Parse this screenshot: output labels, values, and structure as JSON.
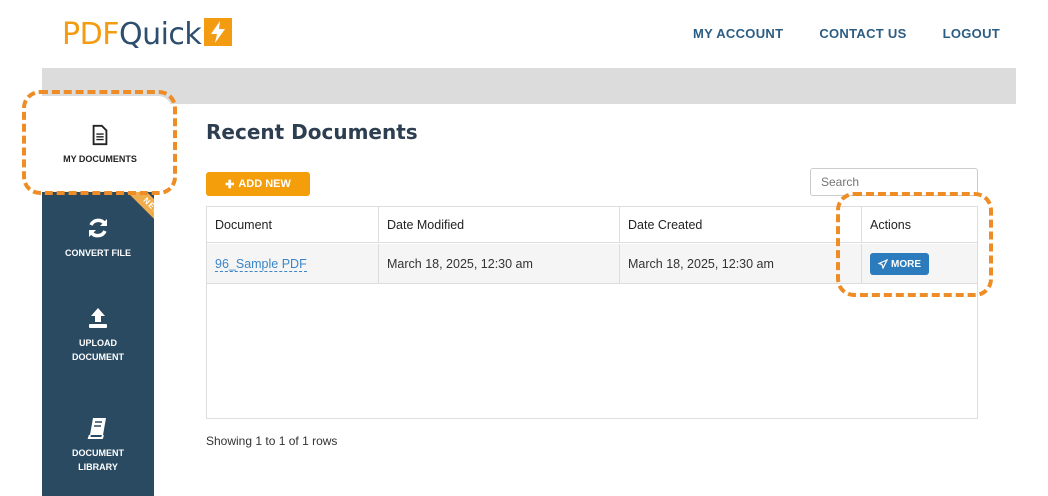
{
  "brand": {
    "part1": "PDF",
    "part2": "Quick",
    "logo_icon": "lightning-bolt-icon"
  },
  "topnav": [
    {
      "label": "MY ACCOUNT"
    },
    {
      "label": "CONTACT US"
    },
    {
      "label": "LOGOUT"
    }
  ],
  "sidebar": {
    "items": [
      {
        "label": "MY DOCUMENTS",
        "icon": "document-icon",
        "active": true
      },
      {
        "label": "CONVERT FILE",
        "icon": "refresh-icon",
        "badge": "NEW"
      },
      {
        "label": "UPLOAD\nDOCUMENT",
        "icon": "upload-icon"
      },
      {
        "label": "DOCUMENT\nLIBRARY",
        "icon": "book-icon"
      }
    ]
  },
  "main": {
    "title": "Recent Documents",
    "add_new_label": "ADD NEW",
    "search_placeholder": "Search",
    "columns": [
      "Document",
      "Date Modified",
      "Date Created",
      "Actions"
    ],
    "rows": [
      {
        "document": "96_Sample PDF",
        "modified": "March 18, 2025, 12:30 am",
        "created": "March 18, 2025, 12:30 am",
        "action": "MORE"
      }
    ],
    "pagination_text": "Showing 1 to 1 of 1 rows"
  },
  "colors": {
    "accent": "#f39c12",
    "sidebar": "#2a4a62",
    "link": "#2b5d84",
    "highlight": "#ee8c25"
  }
}
